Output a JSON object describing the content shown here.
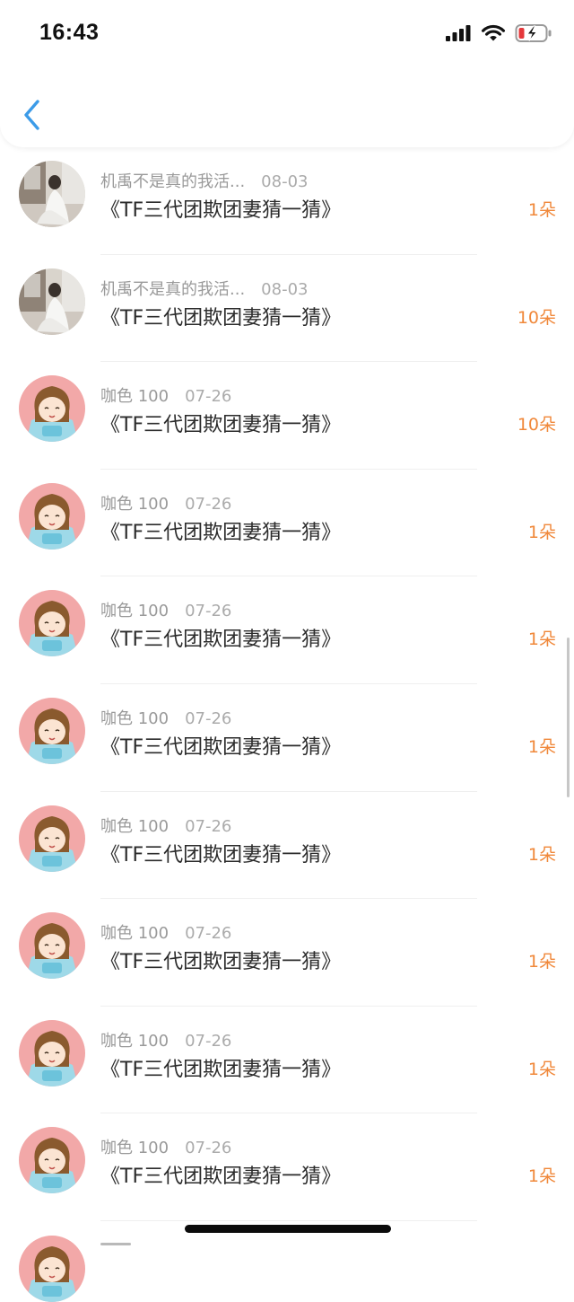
{
  "status_bar": {
    "time": "16:43"
  },
  "rows": [
    {
      "name": "机禹不是真的我活...",
      "date": "08-03",
      "title": "《TF三代团欺团妻猜一猜》",
      "count": "1朵",
      "avatar": "photo"
    },
    {
      "name": "机禹不是真的我活...",
      "date": "08-03",
      "title": "《TF三代团欺团妻猜一猜》",
      "count": "10朵",
      "avatar": "photo"
    },
    {
      "name": "咖色 100",
      "date": "07-26",
      "title": "《TF三代团欺团妻猜一猜》",
      "count": "10朵",
      "avatar": "anime"
    },
    {
      "name": "咖色 100",
      "date": "07-26",
      "title": "《TF三代团欺团妻猜一猜》",
      "count": "1朵",
      "avatar": "anime"
    },
    {
      "name": "咖色 100",
      "date": "07-26",
      "title": "《TF三代团欺团妻猜一猜》",
      "count": "1朵",
      "avatar": "anime"
    },
    {
      "name": "咖色 100",
      "date": "07-26",
      "title": "《TF三代团欺团妻猜一猜》",
      "count": "1朵",
      "avatar": "anime"
    },
    {
      "name": "咖色 100",
      "date": "07-26",
      "title": "《TF三代团欺团妻猜一猜》",
      "count": "1朵",
      "avatar": "anime"
    },
    {
      "name": "咖色 100",
      "date": "07-26",
      "title": "《TF三代团欺团妻猜一猜》",
      "count": "1朵",
      "avatar": "anime"
    },
    {
      "name": "咖色 100",
      "date": "07-26",
      "title": "《TF三代团欺团妻猜一猜》",
      "count": "1朵",
      "avatar": "anime"
    },
    {
      "name": "咖色 100",
      "date": "07-26",
      "title": "《TF三代团欺团妻猜一猜》",
      "count": "1朵",
      "avatar": "anime"
    }
  ],
  "icons": {
    "back": "chevron-left-icon",
    "signal": "signal-icon",
    "wifi": "wifi-icon",
    "battery": "battery-charging-icon"
  },
  "colors": {
    "accent": "#3c9be8",
    "count": "#f0883a",
    "battery_low": "#e5383b"
  }
}
